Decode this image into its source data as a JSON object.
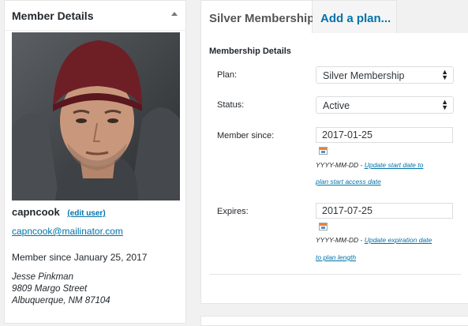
{
  "member_box": {
    "title": "Member Details",
    "username": "capncook",
    "edit_link": "(edit user)",
    "email": "capncook@mailinator.com",
    "member_since": "Member since January 25, 2017",
    "address": [
      "Jesse Pinkman",
      "9809 Margo Street",
      "Albuquerque, NM 87104"
    ]
  },
  "tabs": [
    {
      "label": "Silver Membership",
      "active": true
    },
    {
      "label": "Add a plan...",
      "active": false
    }
  ],
  "details": {
    "section_title": "Membership Details",
    "plan": {
      "label": "Plan:",
      "value": "Silver Membership"
    },
    "status": {
      "label": "Status:",
      "value": "Active"
    },
    "member_since": {
      "label": "Member since:",
      "value": "2017-01-25",
      "hint_format": "YYYY-MM-DD - ",
      "hint_link_1": "Update start date to",
      "hint_link_2": "plan start access date"
    },
    "expires": {
      "label": "Expires:",
      "value": "2017-07-25",
      "hint_format": "YYYY-MM-DD - ",
      "hint_link_1": "Update expiration date",
      "hint_link_2": "to plan length"
    }
  }
}
